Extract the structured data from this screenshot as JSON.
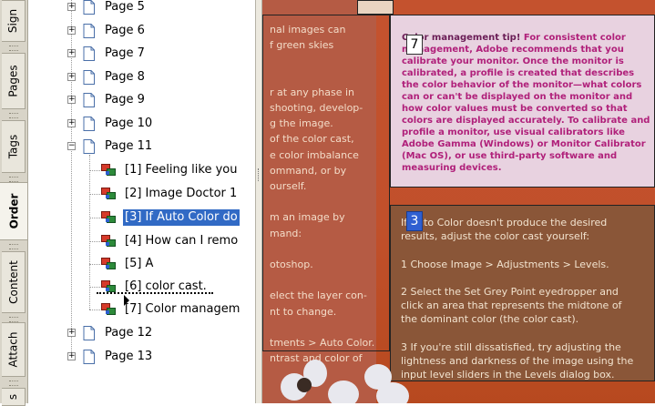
{
  "tabs": [
    {
      "label": "Sign",
      "active": false
    },
    {
      "label": "Pages",
      "active": false
    },
    {
      "label": "Tags",
      "active": false
    },
    {
      "label": "Order",
      "active": true
    },
    {
      "label": "Content",
      "active": false
    },
    {
      "label": "Attach",
      "active": false
    },
    {
      "label": "s",
      "active": false
    }
  ],
  "tree": {
    "pages_before": [
      "Page 5",
      "Page 6",
      "Page 7",
      "Page 8",
      "Page 9",
      "Page 10"
    ],
    "expanded_page": "Page 11",
    "children": [
      {
        "label": "[1]  Feeling like you",
        "selected": false
      },
      {
        "label": "[2]  Image Doctor 1",
        "selected": false
      },
      {
        "label": "[3]  If Auto Color do",
        "selected": true
      },
      {
        "label": "[4]  How can I remo",
        "selected": false
      },
      {
        "label": "[5]  A",
        "selected": false
      },
      {
        "label": "[6]  color cast.",
        "selected": false
      },
      {
        "label": "[7]  Color managem",
        "selected": false
      }
    ],
    "pages_after": [
      "Page 12",
      "Page 13"
    ]
  },
  "document": {
    "left_lines": [
      "nal images can",
      "f green skies",
      "",
      "",
      "r at any phase in",
      "shooting, develop-",
      "g the image.",
      "of the color cast,",
      "e color imbalance",
      "ommand, or by",
      "ourself.",
      "",
      "m an image by",
      "mand:",
      "",
      "otoshop.",
      "",
      "elect the layer con-",
      "nt to change.",
      "",
      "tments > Auto Color.",
      "ntrast and color of"
    ],
    "tip_badge": "7",
    "tip_heading": "Color management tip!",
    "tip_body": "For consistent color management, Adobe recommends that you calibrate your monitor. Once the monitor is calibrated, a profile is created that describes the color behavior of the monitor—what colors can or can't be displayed on the monitor and how color values must be converted so that colors are displayed accurately. To calibrate and profile a monitor, use visual calibrators like Adobe Gamma (Windows) or Monitor Calibrator (Mac OS), or use third-party software and measuring devices.",
    "steps_badge": "3",
    "steps_lines": [
      "If Auto Color doesn't produce the desired",
      "results, adjust the color cast yourself:",
      "",
      "1    Choose Image > Adjustments > Levels.",
      "",
      "2    Select the Set Grey Point eyedropper and",
      "click an area that represents the midtone of",
      "the dominant color (the color cast).",
      "",
      "3    If you're still dissatisfied, try adjusting the",
      "lightness and darkness of the image using the",
      "input level sliders in the Levels dialog box."
    ]
  }
}
